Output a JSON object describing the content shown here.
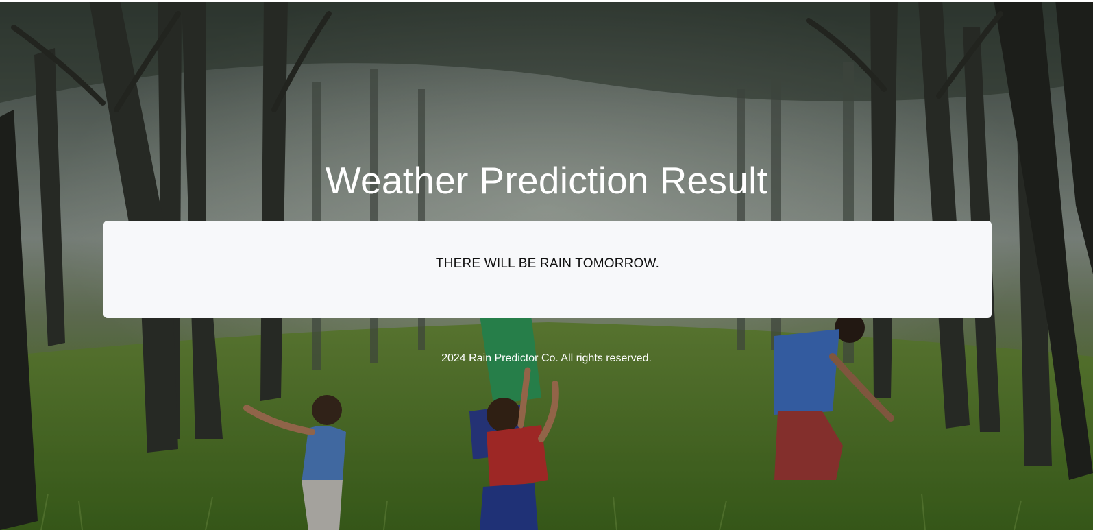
{
  "page": {
    "title": "Weather Prediction Result",
    "result": "THERE WILL BE RAIN TOMORROW.",
    "footer": "2024 Rain Predictor Co. All rights reserved."
  },
  "background": {
    "subject": "children jumping in a misty forest clearing",
    "colors": {
      "sky_mist": "#8a9590",
      "tree_trunk": "#2e2f2a",
      "grass": "#5f8a2e",
      "card": "#f7f8fa"
    }
  }
}
